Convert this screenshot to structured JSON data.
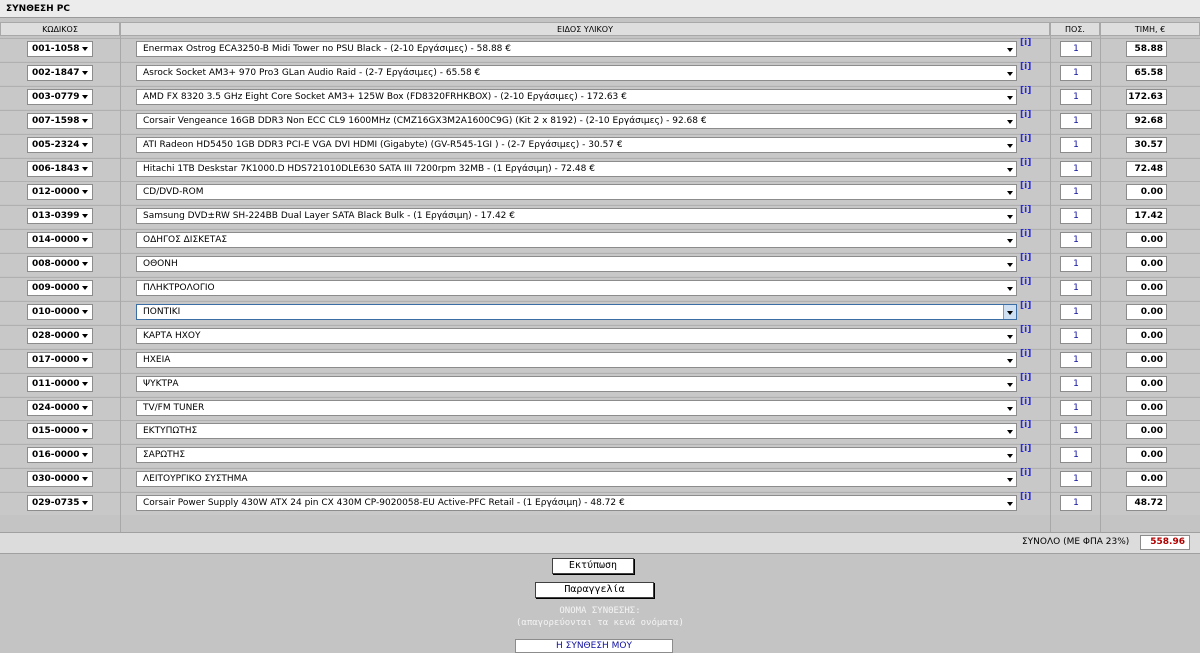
{
  "title": "ΣΥΝΘΕΣΗ PC",
  "headers": {
    "code": "ΚΩΔΙΚΟΣ",
    "item": "ΕΙΔΟΣ ΥΛΙΚΟΥ",
    "qty": "ΠΟΣ.",
    "price": "ΤΙΜΗ, €"
  },
  "info_label": "[i]",
  "rows": [
    {
      "code": "001-1058",
      "item": "Enermax Ostrog ECA3250-B Midi Tower no PSU Black - (2-10 Εργάσιμες) - 58.88 €",
      "qty": "1",
      "price": "58.88"
    },
    {
      "code": "002-1847",
      "item": "Asrock Socket AM3+ 970 Pro3 GLan Audio Raid - (2-7 Εργάσιμες) - 65.58 €",
      "qty": "1",
      "price": "65.58"
    },
    {
      "code": "003-0779",
      "item": "AMD FX 8320 3.5 GHz Eight Core Socket AM3+ 125W Box (FD8320FRHKBOX) - (2-10 Εργάσιμες) - 172.63 €",
      "qty": "1",
      "price": "172.63"
    },
    {
      "code": "007-1598",
      "item": "Corsair Vengeance 16GB DDR3 Non ECC CL9 1600MHz (CMZ16GX3M2A1600C9G) (Kit 2 x 8192) - (2-10 Εργάσιμες) - 92.68 €",
      "qty": "1",
      "price": "92.68"
    },
    {
      "code": "005-2324",
      "item": "ATI Radeon HD5450 1GB DDR3 PCI-E VGA DVI HDMI (Gigabyte) (GV-R545-1GI ) - (2-7 Εργάσιμες) - 30.57 €",
      "qty": "1",
      "price": "30.57"
    },
    {
      "code": "006-1843",
      "item": "Hitachi 1TB Deskstar 7K1000.D HDS721010DLE630 SATA III 7200rpm 32MB - (1 Εργάσιμη) - 72.48 €",
      "qty": "1",
      "price": "72.48"
    },
    {
      "code": "012-0000",
      "item": "CD/DVD-ROM",
      "qty": "1",
      "price": "0.00"
    },
    {
      "code": "013-0399",
      "item": "Samsung DVD±RW SH-224BB Dual Layer SATA Black Bulk - (1 Εργάσιμη) - 17.42 €",
      "qty": "1",
      "price": "17.42"
    },
    {
      "code": "014-0000",
      "item": "ΟΔΗΓΟΣ ΔΙΣΚΕΤΑΣ",
      "qty": "1",
      "price": "0.00"
    },
    {
      "code": "008-0000",
      "item": "ΟΘΟΝΗ",
      "qty": "1",
      "price": "0.00"
    },
    {
      "code": "009-0000",
      "item": "ΠΛΗΚΤΡΟΛΟΓΙΟ",
      "qty": "1",
      "price": "0.00"
    },
    {
      "code": "010-0000",
      "item": "ΠΟΝΤΙΚΙ",
      "qty": "1",
      "price": "0.00"
    },
    {
      "code": "028-0000",
      "item": "ΚΑΡΤΑ ΗΧΟΥ",
      "qty": "1",
      "price": "0.00"
    },
    {
      "code": "017-0000",
      "item": "ΗΧΕΙΑ",
      "qty": "1",
      "price": "0.00"
    },
    {
      "code": "011-0000",
      "item": "ΨΥΚΤΡΑ",
      "qty": "1",
      "price": "0.00"
    },
    {
      "code": "024-0000",
      "item": "TV/FM TUNER",
      "qty": "1",
      "price": "0.00"
    },
    {
      "code": "015-0000",
      "item": "ΕΚΤΥΠΩΤΗΣ",
      "qty": "1",
      "price": "0.00"
    },
    {
      "code": "016-0000",
      "item": "ΣΑΡΩΤΗΣ",
      "qty": "1",
      "price": "0.00"
    },
    {
      "code": "030-0000",
      "item": "ΛΕΙΤΟΥΡΓΙΚΟ ΣΥΣΤΗΜΑ",
      "qty": "1",
      "price": "0.00"
    },
    {
      "code": "029-0735",
      "item": "Corsair Power Supply 430W ATX 24 pin CX 430M CP-9020058-EU Active-PFC Retail - (1 Εργάσιμη) - 48.72 €",
      "qty": "1",
      "price": "48.72"
    }
  ],
  "total": {
    "label": "ΣΥΝΟΛΟ (ΜΕ ΦΠΑ 23%)",
    "value": "558.96"
  },
  "buttons": {
    "print": "Εκτύπωση",
    "order": "Παραγγελία"
  },
  "name_section": {
    "label": "ΟΝΟΜΑ ΣΥΝΘΕΣΗΣ:",
    "hint": "(απαγορεύονται τα κενά ονόματα)",
    "value": "Η ΣΥΝΘΕΣΗ ΜΟΥ"
  }
}
